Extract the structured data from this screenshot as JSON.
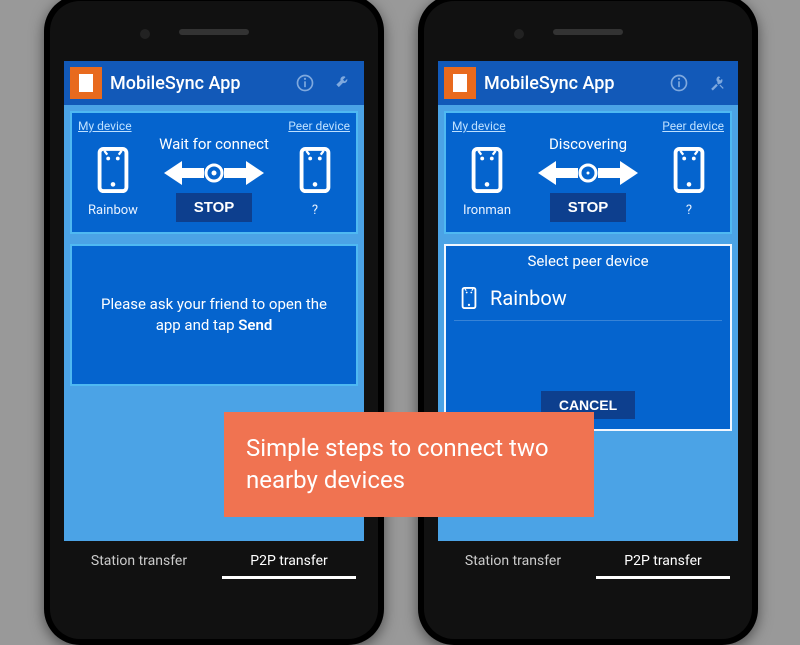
{
  "app": {
    "title": "MobileSync App"
  },
  "colors": {
    "accent": "#0564ce",
    "brand": "#e86a1e",
    "header": "#1259b8",
    "sky": "#4ba3e6",
    "caption": "#f07351"
  },
  "phone1": {
    "header": {
      "info_icon": "info-icon",
      "settings_icon": "wrench-icon"
    },
    "connect": {
      "my_device_link": "My device",
      "peer_device_link": "Peer device",
      "status": "Wait for connect",
      "stop_label": "STOP",
      "my_name": "Rainbow",
      "peer_name": "?"
    },
    "message": {
      "text_prefix": "Please ask your friend to open the app and tap ",
      "text_bold": "Send"
    },
    "tabs": {
      "station": "Station transfer",
      "p2p": "P2P transfer"
    }
  },
  "phone2": {
    "header": {
      "info_icon": "info-icon",
      "settings_icon": "tools-icon"
    },
    "connect": {
      "my_device_link": "My device",
      "peer_device_link": "Peer device",
      "status": "Discovering",
      "stop_label": "STOP",
      "my_name": "Ironman",
      "peer_name": "?"
    },
    "peer_select": {
      "title": "Select peer device",
      "items": [
        "Rainbow"
      ],
      "cancel_label": "CANCEL"
    },
    "tabs": {
      "station": "Station transfer",
      "p2p": "P2P transfer"
    }
  },
  "caption": "Simple steps to connect two nearby devices"
}
